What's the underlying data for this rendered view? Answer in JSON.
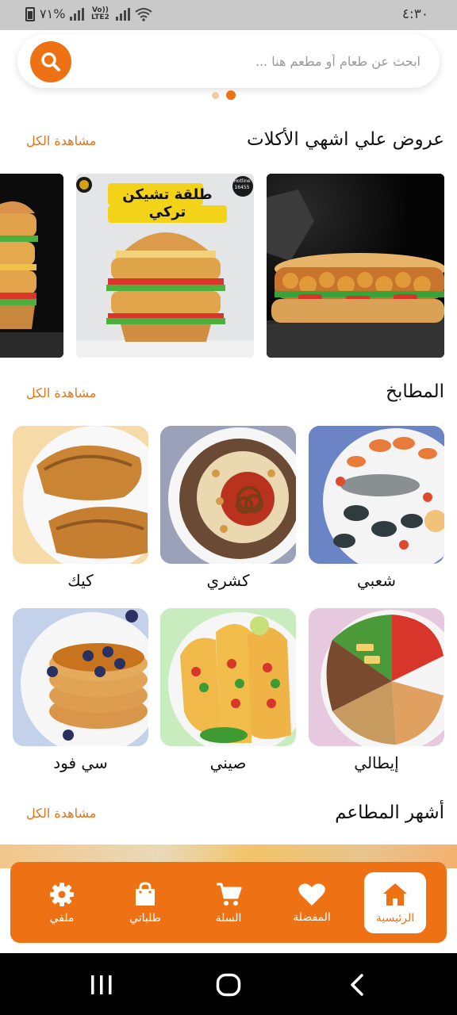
{
  "status_bar": {
    "time": "٤:٣٠",
    "battery": "٧١%",
    "network": "Vo)) LTE2"
  },
  "search": {
    "placeholder": "ابحث عن طعام أو مطعم هنا ..."
  },
  "offers_section": {
    "title": "عروض علي اشهي الأكلات",
    "see_all": "مشاهدة الكل",
    "banner_text": "طلقة تشيكن تركي",
    "hotline_label": "Hotline",
    "hotline_number": "16455"
  },
  "cuisines_section": {
    "title": "المطابخ",
    "see_all": "مشاهدة الكل",
    "items": [
      {
        "label": "شعبي"
      },
      {
        "label": "كشري"
      },
      {
        "label": "كيك"
      },
      {
        "label": "إيطالي"
      },
      {
        "label": "صيني"
      },
      {
        "label": "سي فود"
      }
    ]
  },
  "restaurants_section": {
    "title": "أشهر المطاعم",
    "see_all": "مشاهدة الكل"
  },
  "bottom_nav": {
    "items": [
      {
        "label": "الرئيسية",
        "icon": "home-icon",
        "active": true
      },
      {
        "label": "المفضلة",
        "icon": "heart-icon"
      },
      {
        "label": "السلة",
        "icon": "cart-icon"
      },
      {
        "label": "طلباتي",
        "icon": "bag-icon"
      },
      {
        "label": "ملفي",
        "icon": "gear-icon"
      }
    ]
  },
  "colors": {
    "accent": "#ee7214",
    "see_all": "#e3731c"
  }
}
